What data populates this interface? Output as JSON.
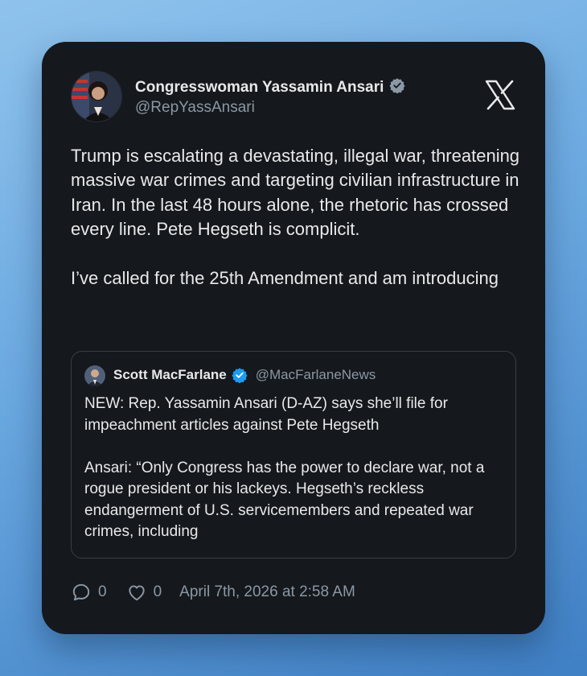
{
  "tweet": {
    "author_name": "Congresswoman Yassamin Ansari",
    "author_handle": "@RepYassAnsari",
    "text_paragraphs": [
      "Trump is escalating a devastating, illegal war, threatening massive war crimes and targeting civilian infrastructure in Iran. In the last 48 hours alone, the rhetoric has crossed every line. Pete Hegseth is complicit.",
      "I’ve called for the 25th Amendment and am introducing"
    ],
    "verified_badge_color": "#8b98a5",
    "platform_icon": "x-logo-icon"
  },
  "quoted": {
    "author_name": "Scott MacFarlane",
    "author_handle": "@MacFarlaneNews",
    "verified_badge_color": "#1d9bf0",
    "text_paragraphs": [
      "NEW:  Rep. Yassamin Ansari (D-AZ) says she’ll file for impeachment articles against Pete Hegseth",
      "Ansari: “Only Congress has the power to declare war, not a rogue president or his lackeys. Hegseth’s reckless endangerment of U.S. servicemembers and repeated war crimes, including"
    ]
  },
  "footer": {
    "reply_count": "0",
    "like_count": "0",
    "timestamp": "April 7th, 2026 at 2:58 AM"
  }
}
